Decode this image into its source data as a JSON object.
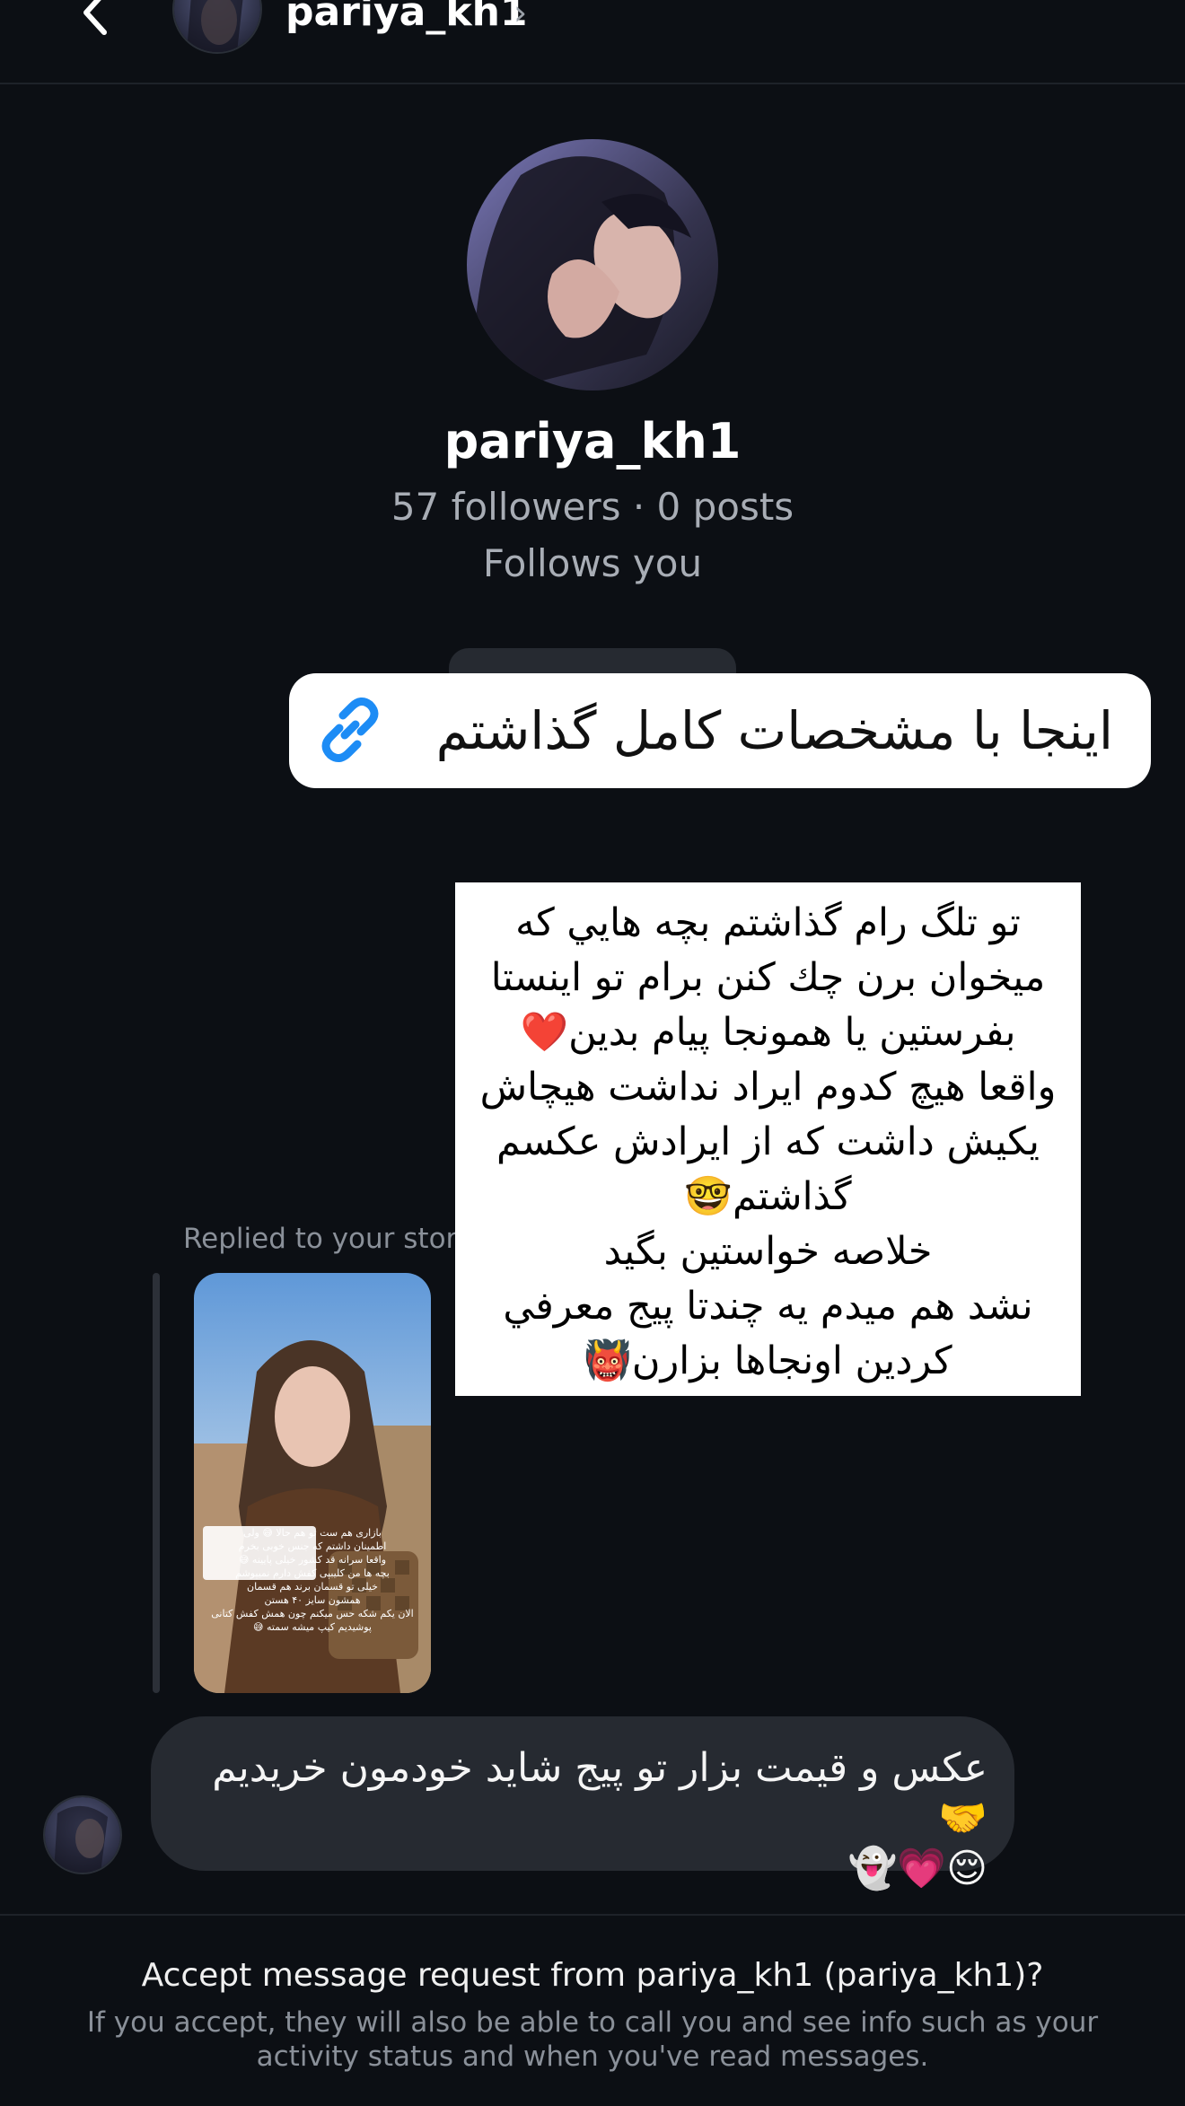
{
  "header": {
    "username": "pariya_kh1",
    "chevron": "›",
    "back_icon": "chevron-left-icon"
  },
  "profile": {
    "username": "pariya_kh1",
    "stats": "57 followers · 0 posts",
    "follows": "Follows you"
  },
  "link_sticker": {
    "text": "اینجا با مشخصات کامل گذاشتم",
    "icon": "link-icon"
  },
  "text_box": {
    "text": "تو تلگ رام گذاشتم بچه هايي كه\nميخوان برن چك كنن برام تو اينستا\nبفرستين يا همونجا پيام بدين❤️\nواقعا هيچ كدوم ايراد نداشت هيچاش\nيكيش داشت كه از ايرادش عكسم\nگذاشتم🤓\nخلاصه خواستين بگيد\nنشد هم ميدم يه چندتا پيج معرفي\nكردين اونجاها بزارن👹"
  },
  "reply": {
    "label": "Replied to your stor",
    "story_caption": "بازاری هم ست تو هم حالا 😅 ولی\nاطمینان داشتم که جنس خوبی بخرم\nواقعا سرانه قد کشور خیلی پایینه 😅\nبچه ها من کلیبپی کفش دارم نمیپوشم\nخیلی تو قسمان برند هم قسمان\nهمشون سایز ۴۰ هستن\nالان یکم شکه حس میکنم چون همش کفش کتانی\nپوشیدیم کیپ میشه سمته 😅"
  },
  "message": {
    "text": "عکس و قیمت بزار تو پیج شاید خودمون خریدیم🤝\n😌💗👻"
  },
  "footer": {
    "title": "Accept message request from pariya_kh1 (pariya_kh1)?",
    "description": "If you accept, they will also be able to call you and see info such as your activity status and when you've read messages."
  },
  "colors": {
    "background": "#0c0f14",
    "bubble": "#262a31",
    "link_icon": "#1d8cf5",
    "muted_text": "#a8adb5"
  }
}
